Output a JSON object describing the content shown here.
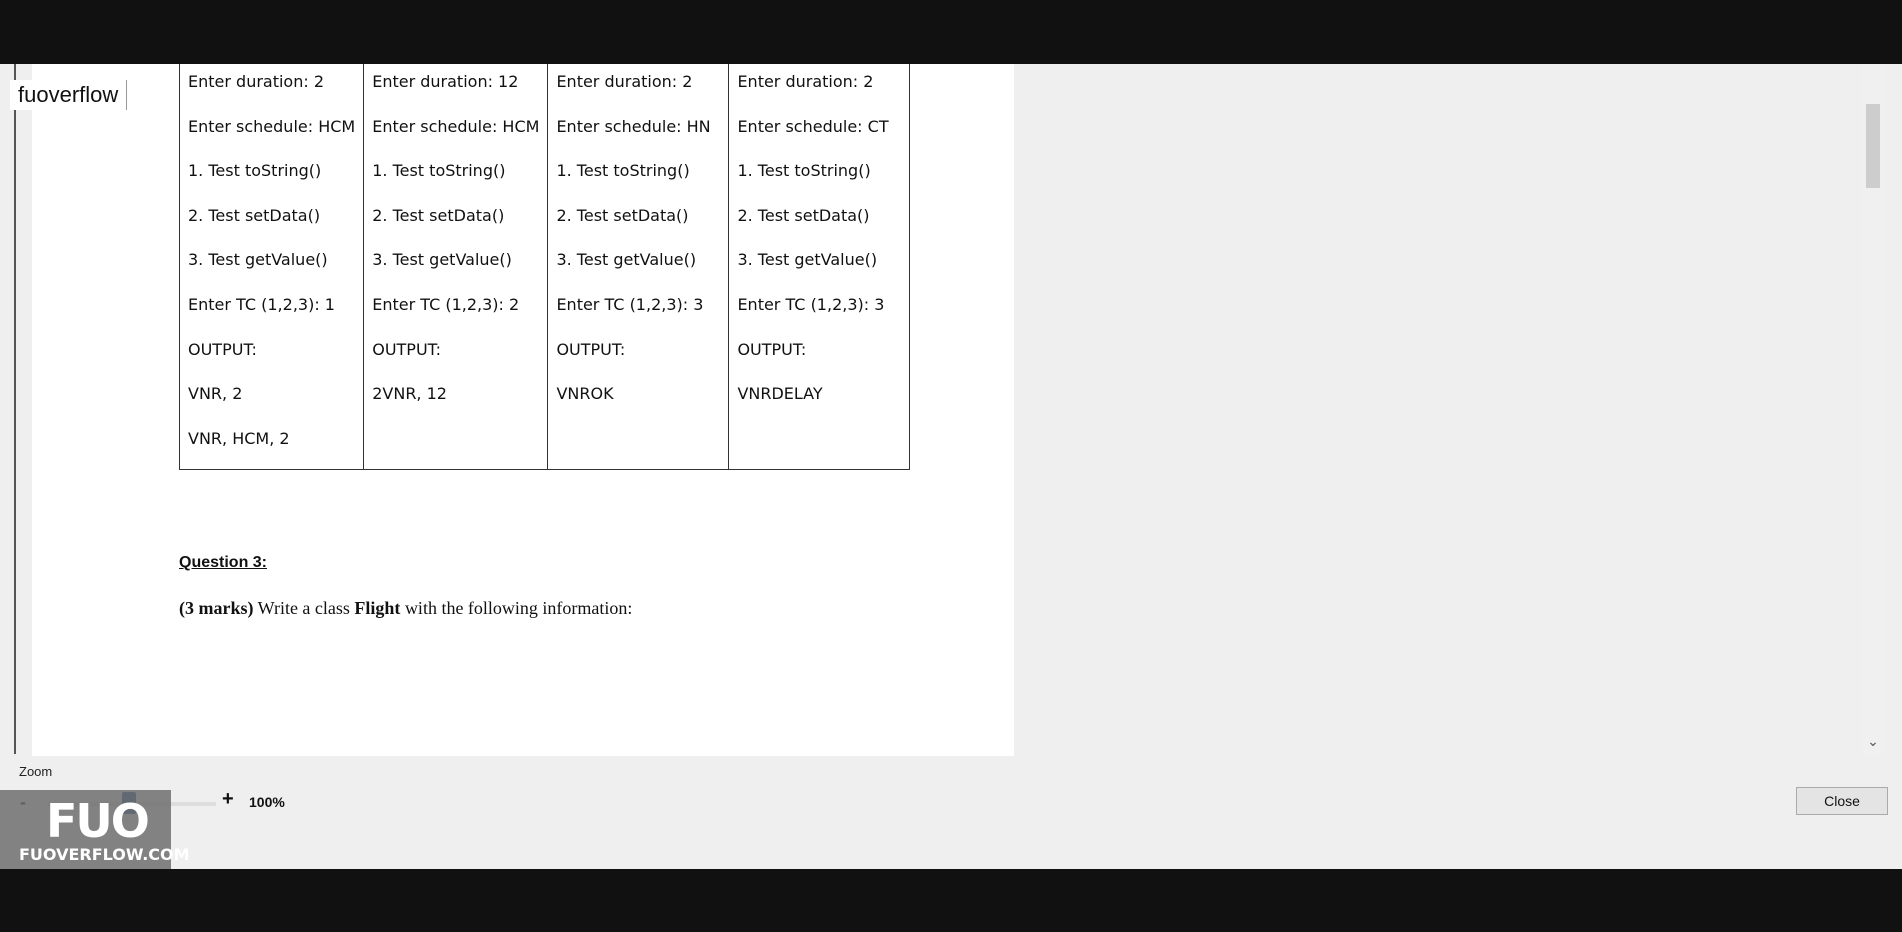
{
  "watermark_label": "fuoverflow",
  "table": {
    "columns": [
      [
        "Enter duration: 2",
        "Enter schedule: HCM",
        "1. Test toString()",
        "2. Test setData()",
        "3. Test getValue()",
        "Enter TC (1,2,3): 1",
        "OUTPUT:",
        "VNR, 2",
        "VNR, HCM, 2"
      ],
      [
        "Enter duration: 12",
        "Enter schedule: HCM",
        "1. Test toString()",
        "2. Test setData()",
        "3. Test getValue()",
        "Enter TC (1,2,3): 2",
        "OUTPUT:",
        "2VNR, 12"
      ],
      [
        "Enter duration: 2",
        "Enter schedule: HN",
        "1. Test toString()",
        "2. Test setData()",
        "3. Test getValue()",
        "Enter TC (1,2,3): 3",
        "OUTPUT:",
        "VNROK"
      ],
      [
        "Enter duration: 2",
        "Enter schedule: CT",
        "1. Test toString()",
        "2. Test setData()",
        "3. Test getValue()",
        "Enter TC (1,2,3): 3",
        "OUTPUT:",
        "VNRDELAY"
      ]
    ]
  },
  "question": {
    "title": "Question 3:",
    "marks": "(3 marks)",
    "text1": " Write a class ",
    "class_name": "Flight",
    "text2": " with the following information:"
  },
  "zoom": {
    "label": "Zoom",
    "minus": "-",
    "plus": "+",
    "value": "100%",
    "level_fraction": 0.45
  },
  "close_label": "Close",
  "logo": {
    "big": "FUO",
    "small": "FUOVERFLOW.COM"
  },
  "icons": {
    "scroll_down": "chevron-down-icon"
  }
}
